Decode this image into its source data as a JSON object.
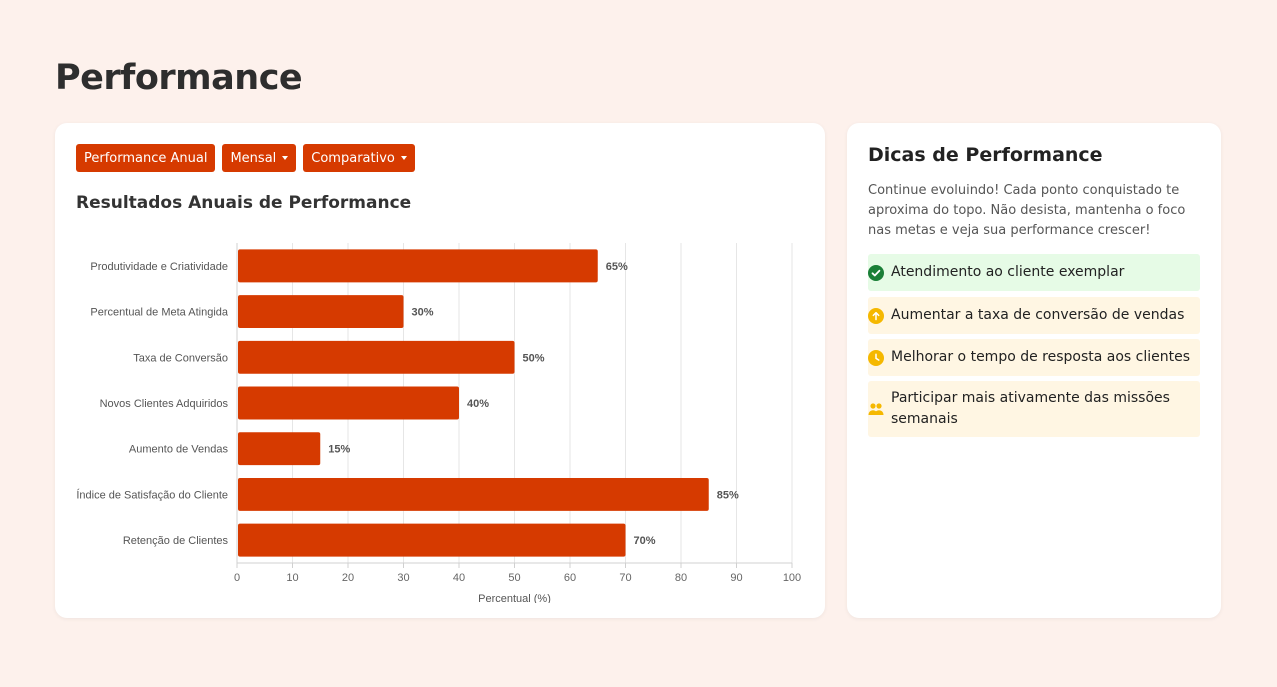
{
  "page": {
    "title": "Performance"
  },
  "chart_card": {
    "buttons": [
      {
        "label": "Performance Anual",
        "dropdown": false
      },
      {
        "label": "Mensal",
        "dropdown": true
      },
      {
        "label": "Comparativo",
        "dropdown": true
      }
    ],
    "title": "Resultados Anuais de Performance"
  },
  "chart_data": {
    "type": "bar",
    "orientation": "horizontal",
    "categories": [
      "Produtividade e Criatividade",
      "Percentual de Meta Atingida",
      "Taxa de Conversão",
      "Novos Clientes Adquiridos",
      "Aumento de Vendas",
      "Índice de Satisfação do Cliente",
      "Retenção de Clientes"
    ],
    "values": [
      65,
      30,
      50,
      40,
      15,
      85,
      70
    ],
    "value_labels": [
      "65%",
      "30%",
      "50%",
      "40%",
      "15%",
      "85%",
      "70%"
    ],
    "xlabel": "Percentual (%)",
    "ylabel": "",
    "xlim": [
      0,
      100
    ],
    "xticks": [
      0,
      10,
      20,
      30,
      40,
      50,
      60,
      70,
      80,
      90,
      100
    ],
    "grid": true,
    "bar_color": "#d63a00"
  },
  "tips": {
    "title": "Dicas de Performance",
    "text": "Continue evoluindo! Cada ponto conquistado te aproxima do topo. Não desista, mantenha o foco nas metas e veja sua performance crescer!",
    "items": [
      {
        "label": "Atendimento ao cliente exemplar",
        "icon": "check-circle-icon",
        "status": "done"
      },
      {
        "label": "Aumentar a taxa de conversão de vendas",
        "icon": "arrow-up-circle-icon",
        "status": "todo"
      },
      {
        "label": "Melhorar o tempo de resposta aos clientes",
        "icon": "clock-icon",
        "status": "todo"
      },
      {
        "label": "Participar mais ativamente das missões semanais",
        "icon": "users-icon",
        "status": "todo"
      }
    ]
  },
  "colors": {
    "accent": "#d63a00",
    "background": "#fdf1ec",
    "success": "#1a7f37",
    "warning": "#f5b800"
  }
}
